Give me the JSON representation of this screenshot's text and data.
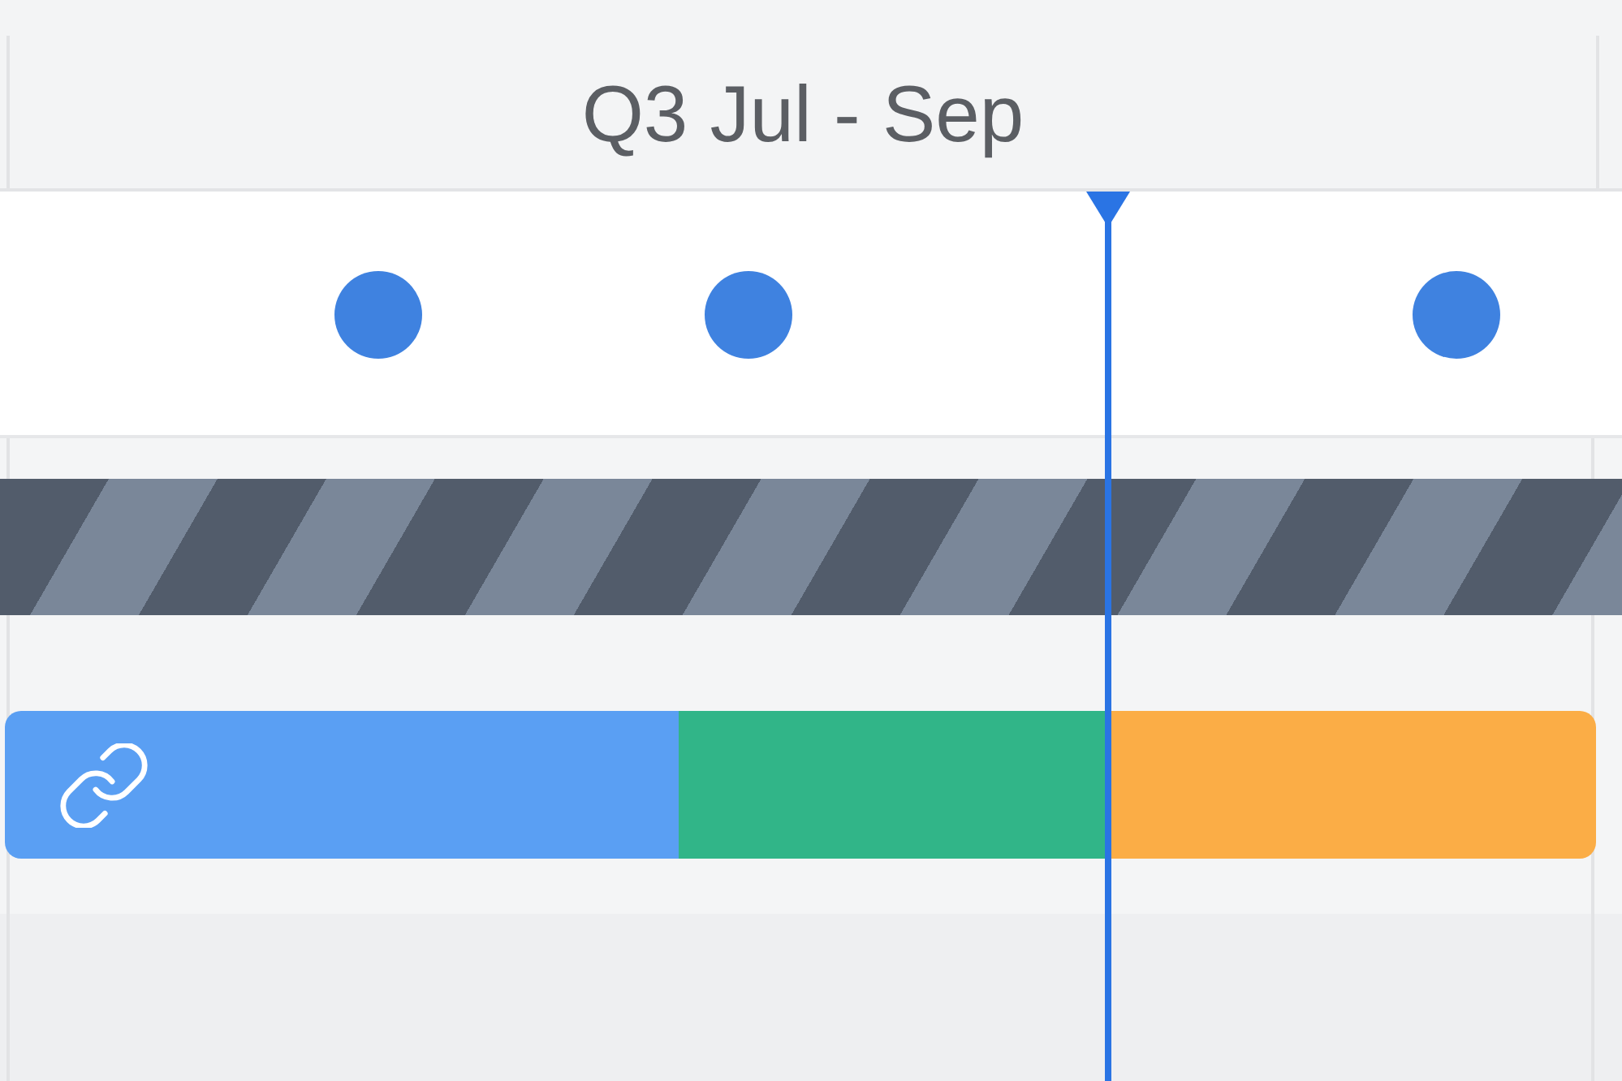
{
  "header": {
    "period": "Q3 Jul - Sep"
  },
  "milestones": [
    {
      "color": "#3f82e0"
    },
    {
      "color": "#3f82e0"
    },
    {
      "color": "#3f82e0"
    }
  ],
  "today_marker": true,
  "rows": [
    {
      "kind": "striped"
    },
    {
      "kind": "segmented",
      "segments": [
        {
          "color": "#5a9ff3"
        },
        {
          "color": "#31b588"
        },
        {
          "color": "#fbad46"
        }
      ]
    }
  ]
}
